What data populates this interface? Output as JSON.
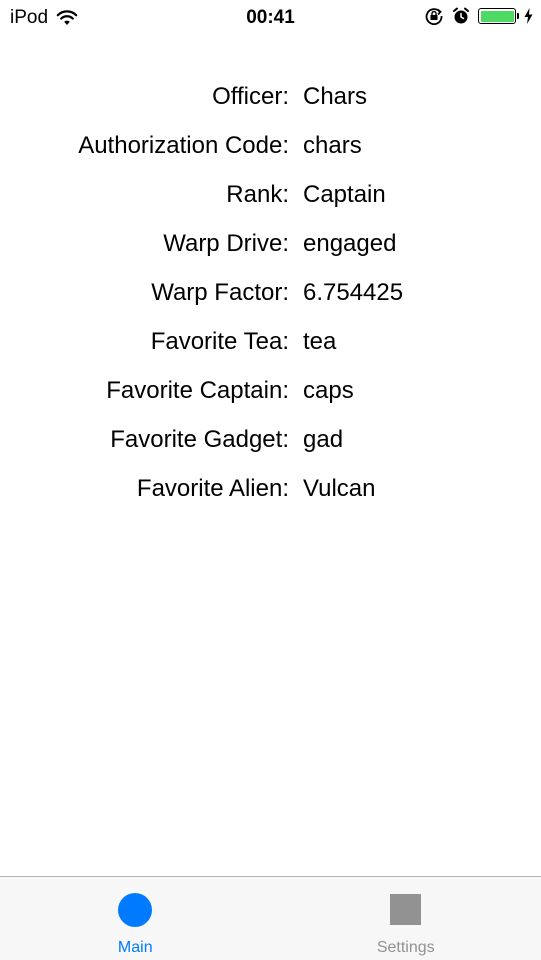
{
  "status_bar": {
    "carrier": "iPod",
    "time": "00:41",
    "battery_color": "#4cd964",
    "icons": [
      "wifi-icon",
      "rotation-lock-icon",
      "alarm-icon",
      "battery-icon",
      "charging-icon"
    ]
  },
  "fields": [
    {
      "label": "Officer:",
      "value": "Chars"
    },
    {
      "label": "Authorization Code:",
      "value": "chars"
    },
    {
      "label": "Rank:",
      "value": "Captain"
    },
    {
      "label": "Warp Drive:",
      "value": "engaged"
    },
    {
      "label": "Warp Factor:",
      "value": "6.754425"
    },
    {
      "label": "Favorite Tea:",
      "value": "tea"
    },
    {
      "label": "Favorite Captain:",
      "value": "caps"
    },
    {
      "label": "Favorite Gadget:",
      "value": "gad"
    },
    {
      "label": "Favorite Alien:",
      "value": "Vulcan"
    }
  ],
  "tab_bar": {
    "accent_color": "#007aff",
    "inactive_color": "#929292",
    "tabs": [
      {
        "label": "Main",
        "icon": "circle-icon",
        "selected": true
      },
      {
        "label": "Settings",
        "icon": "square-icon",
        "selected": false
      }
    ]
  }
}
